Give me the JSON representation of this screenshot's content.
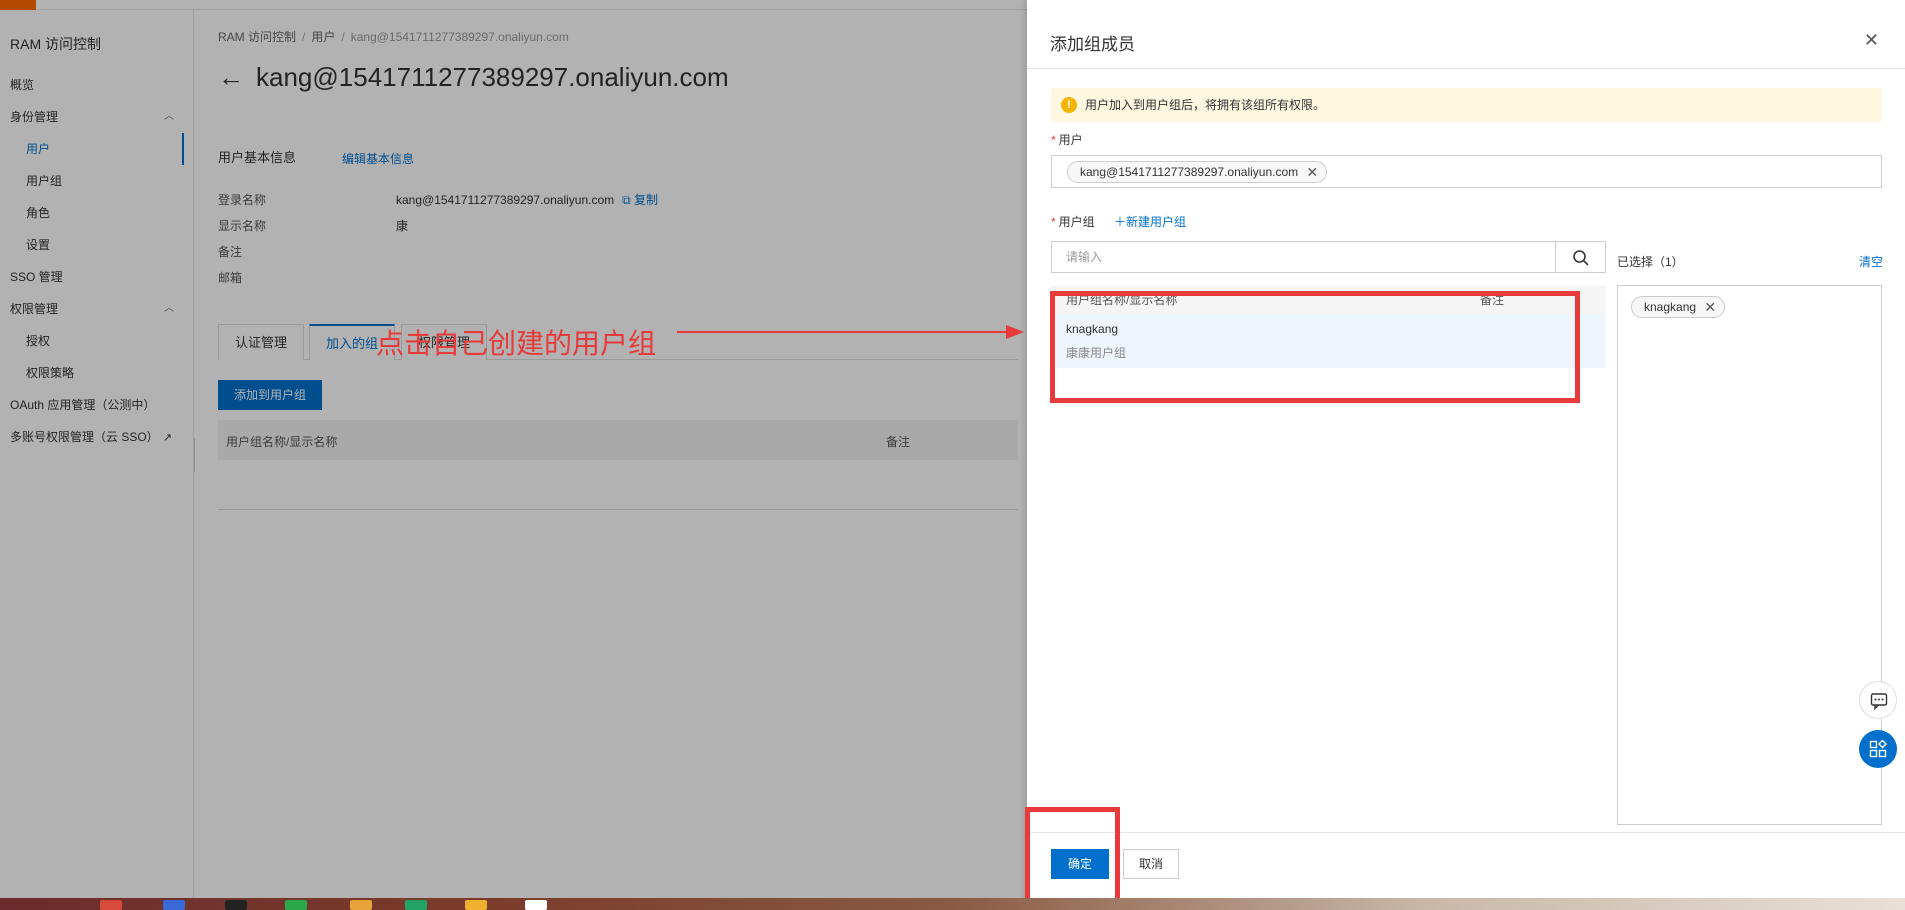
{
  "sidebar": {
    "title": "RAM 访问控制",
    "items": [
      {
        "label": "概览"
      },
      {
        "label": "身份管理"
      },
      {
        "label": "用户"
      },
      {
        "label": "用户组"
      },
      {
        "label": "角色"
      },
      {
        "label": "设置"
      },
      {
        "label": "SSO 管理"
      },
      {
        "label": "权限管理"
      },
      {
        "label": "授权"
      },
      {
        "label": "权限策略"
      },
      {
        "label": "OAuth 应用管理（公测中）"
      },
      {
        "label": "多账号权限管理（云 SSO）"
      }
    ]
  },
  "breadcrumb": [
    "RAM 访问控制",
    "用户",
    "kang@1541711277389297.onaliyun.com"
  ],
  "page": {
    "title": "kang@1541711277389297.onaliyun.com",
    "section_title": "用户基本信息",
    "edit_link": "编辑基本信息",
    "info": [
      {
        "label": "登录名称",
        "value": "kang@1541711277389297.onaliyun.com",
        "action": "复制"
      },
      {
        "label": "显示名称",
        "value": "康"
      },
      {
        "label": "备注",
        "value": ""
      },
      {
        "label": "邮箱",
        "value": ""
      }
    ],
    "tabs": [
      "认证管理",
      "加入的组",
      "权限管理"
    ],
    "add_button": "添加到用户组",
    "list_columns": [
      "用户组名称/显示名称",
      "备注"
    ]
  },
  "annotation": {
    "text": "点击自己创建的用户组",
    "color": "#e83a3a"
  },
  "drawer": {
    "title": "添加组成员",
    "notice": "用户加入到用户组后，将拥有该组所有权限。",
    "user_label": "用户",
    "user_tag": "kang@1541711277389297.onaliyun.com",
    "group_label": "用户组",
    "new_group": "新建用户组",
    "search_placeholder": "请输入",
    "table_columns": [
      "用户组名称/显示名称",
      "备注"
    ],
    "groups": [
      {
        "name": "knagkang",
        "display": "康康用户组"
      }
    ],
    "selected_label": "已选择（1）",
    "clear": "清空",
    "selected_tags": [
      "knagkang"
    ],
    "ok": "确定",
    "cancel": "取消"
  },
  "colors": {
    "accent": "#0070cc",
    "annotation": "#e83a3a",
    "notice_bg": "#fff7e0"
  }
}
